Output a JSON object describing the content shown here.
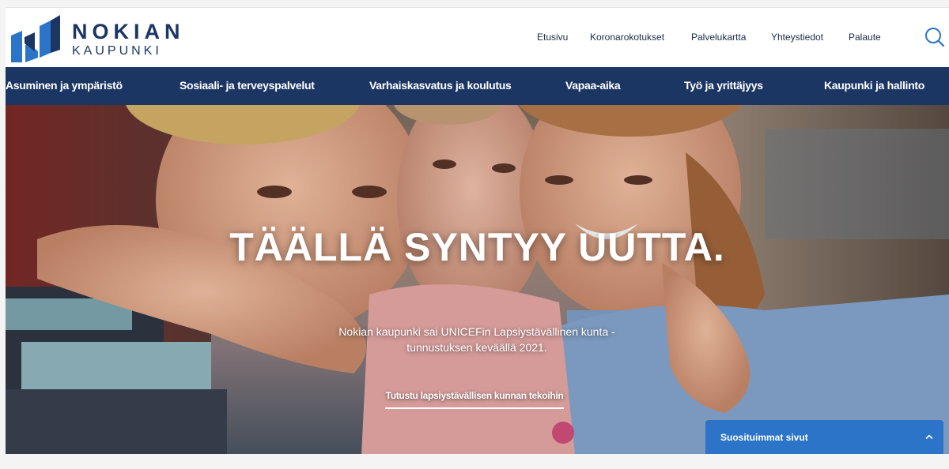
{
  "brand": {
    "name_line1": "NOKIAN",
    "name_line2": "KAUPUNKI",
    "colors": {
      "navy": "#1c3664",
      "accent_blue": "#2b74c7",
      "white": "#ffffff"
    }
  },
  "top_nav": {
    "items": [
      {
        "label": "Etusivu"
      },
      {
        "label": "Koronarokotukset"
      },
      {
        "label": "Palvelukartta"
      },
      {
        "label": "Yhteystiedot"
      },
      {
        "label": "Palaute"
      }
    ],
    "search_icon": "search-icon"
  },
  "main_nav": {
    "items": [
      {
        "label": "Asuminen ja ympäristö"
      },
      {
        "label": "Sosiaali- ja terveyspalvelut"
      },
      {
        "label": "Varhaiskasvatus ja koulutus"
      },
      {
        "label": "Vapaa-aika"
      },
      {
        "label": "Työ ja yrittäjyys"
      },
      {
        "label": "Kaupunki ja hallinto"
      }
    ]
  },
  "hero": {
    "title": "TÄÄLLÄ SYNTYY UUTTA.",
    "subtitle": "Nokian kaupunki sai UNICEFin Lapsiystävällinen kunta -tunnustuksen keväällä 2021.",
    "link_label": "Tutustu lapsiystävällisen kunnan tekoihin"
  },
  "popular_pages": {
    "label": "Suosituimmat sivut",
    "icon": "chevron-up-icon"
  }
}
